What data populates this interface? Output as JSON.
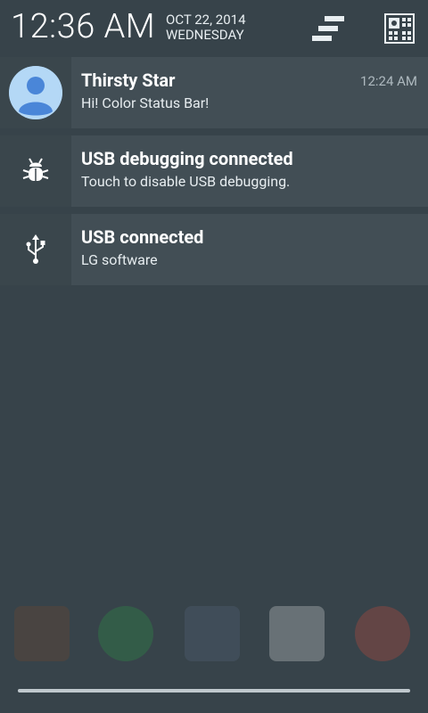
{
  "header": {
    "time": "12:36 AM",
    "date": "OCT 22, 2014",
    "weekday": "WEDNESDAY"
  },
  "notifications": [
    {
      "title": "Thirsty Star",
      "text": "Hi! Color Status Bar!",
      "time": "12:24 AM",
      "icon": "avatar-icon"
    },
    {
      "title": "USB debugging connected",
      "text": "Touch to disable USB debugging.",
      "icon": "bug-icon"
    },
    {
      "title": "USB connected",
      "text": "LG software",
      "icon": "usb-icon"
    }
  ],
  "dock_icons": [
    "contacts-icon",
    "hangouts-icon",
    "apps-grid-icon",
    "gmail-icon",
    "chrome-icon"
  ],
  "colors": {
    "background": "#37434a",
    "card": "#424e55",
    "avatar": "#4a90d9"
  }
}
